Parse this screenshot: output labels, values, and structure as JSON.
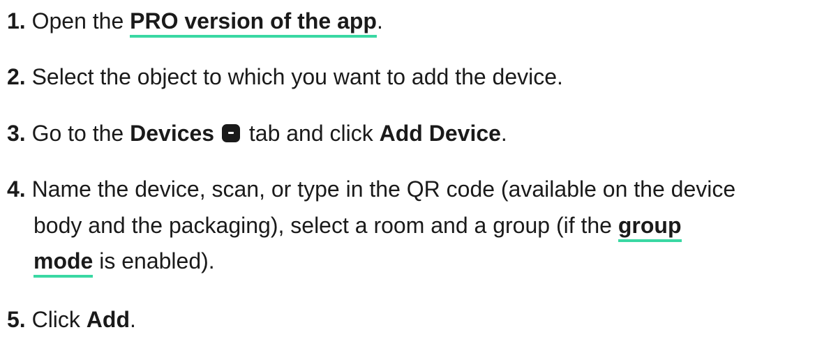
{
  "steps": {
    "s1": {
      "num": "1.",
      "pre": "Open the ",
      "link": "PRO version of the app",
      "post": "."
    },
    "s2": {
      "num": "2.",
      "text": "Select the object to which you want to add the device."
    },
    "s3": {
      "num": "3.",
      "pre": "Go to the ",
      "bold1": "Devices",
      "mid": " tab and click ",
      "bold2": "Add Device",
      "post": ".",
      "icon": "devices-icon"
    },
    "s4": {
      "num": "4.",
      "line1": "Name the device, scan, or type in the QR code (available on the device",
      "line2_pre": "body and the packaging), select a room and a group (if the ",
      "link_part1": "group",
      "link_part2": "mode",
      "line3_post": " is enabled)."
    },
    "s5": {
      "num": "5.",
      "pre": "Click ",
      "bold": "Add",
      "post": "."
    }
  },
  "colors": {
    "link_underline": "#3ad8a3",
    "text": "#1a1a1a"
  }
}
